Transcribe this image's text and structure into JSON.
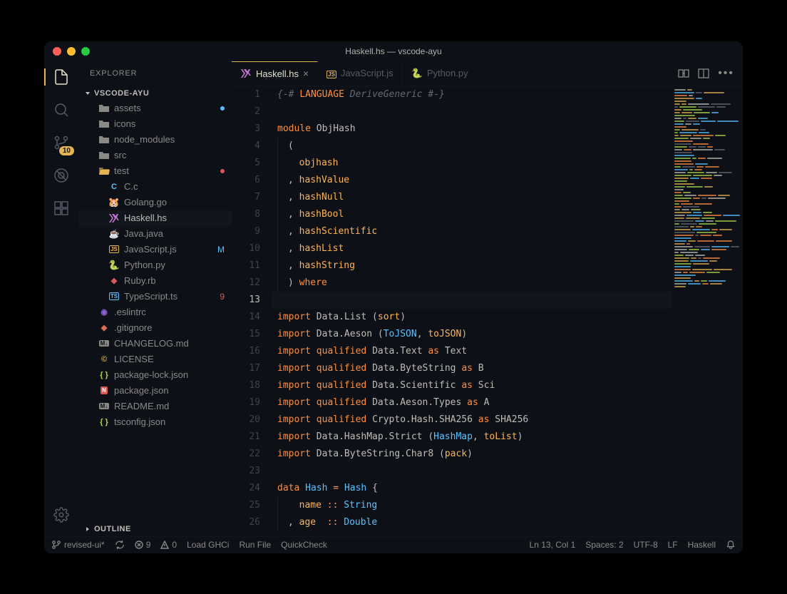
{
  "titlebar": {
    "title": "Haskell.hs — vscode-ayu"
  },
  "activity": {
    "items": [
      {
        "name": "files-icon",
        "active": true
      },
      {
        "name": "search-icon",
        "active": false
      },
      {
        "name": "source-control-icon",
        "active": false,
        "badge": "10"
      },
      {
        "name": "debug-icon",
        "active": false
      },
      {
        "name": "extensions-icon",
        "active": false
      }
    ],
    "bottom": {
      "name": "gear-icon"
    }
  },
  "sidebar": {
    "title": "EXPLORER",
    "project": "VSCODE-AYU",
    "outline": "OUTLINE",
    "tree": [
      {
        "type": "folder",
        "label": "assets",
        "indent": 1,
        "status_dot": "#59c2ff"
      },
      {
        "type": "folder",
        "label": "icons",
        "indent": 1
      },
      {
        "type": "folder",
        "label": "node_modules",
        "indent": 1
      },
      {
        "type": "folder",
        "label": "src",
        "indent": 1
      },
      {
        "type": "folder-open",
        "label": "test",
        "indent": 1,
        "icon_color": "#e6b450",
        "status_dot": "#d95757"
      },
      {
        "type": "file",
        "label": "C.c",
        "indent": 2,
        "icon": "c"
      },
      {
        "type": "file",
        "label": "Golang.go",
        "indent": 2,
        "icon": "go"
      },
      {
        "type": "file",
        "label": "Haskell.hs",
        "indent": 2,
        "icon": "hs",
        "active": true
      },
      {
        "type": "file",
        "label": "Java.java",
        "indent": 2,
        "icon": "java"
      },
      {
        "type": "file",
        "label": "JavaScript.js",
        "indent": 2,
        "icon": "js",
        "status_text": "M",
        "status_color": "#59c2ff"
      },
      {
        "type": "file",
        "label": "Python.py",
        "indent": 2,
        "icon": "py"
      },
      {
        "type": "file",
        "label": "Ruby.rb",
        "indent": 2,
        "icon": "rb"
      },
      {
        "type": "file",
        "label": "TypeScript.ts",
        "indent": 2,
        "icon": "ts",
        "status_text": "9",
        "status_color": "#d95757"
      },
      {
        "type": "file",
        "label": ".eslintrc",
        "indent": 1,
        "icon": "eslint"
      },
      {
        "type": "file",
        "label": ".gitignore",
        "indent": 1,
        "icon": "git"
      },
      {
        "type": "file",
        "label": "CHANGELOG.md",
        "indent": 1,
        "icon": "md"
      },
      {
        "type": "file",
        "label": "LICENSE",
        "indent": 1,
        "icon": "license"
      },
      {
        "type": "file",
        "label": "package-lock.json",
        "indent": 1,
        "icon": "json"
      },
      {
        "type": "file",
        "label": "package.json",
        "indent": 1,
        "icon": "npm"
      },
      {
        "type": "file",
        "label": "README.md",
        "indent": 1,
        "icon": "md"
      },
      {
        "type": "file",
        "label": "tsconfig.json",
        "indent": 1,
        "icon": "json"
      }
    ]
  },
  "tabs": [
    {
      "label": "Haskell.hs",
      "icon": "hs",
      "active": true,
      "close": true
    },
    {
      "label": "JavaScript.js",
      "icon": "js",
      "active": false
    },
    {
      "label": "Python.py",
      "icon": "py",
      "active": false
    }
  ],
  "editor": {
    "current_line": 13,
    "lines": [
      {
        "n": 1,
        "tokens": [
          [
            "c-comment",
            "{-# "
          ],
          [
            "c-keyword",
            "LANGUAGE"
          ],
          [
            "c-comment",
            " DeriveGeneric #-}"
          ]
        ]
      },
      {
        "n": 2,
        "tokens": []
      },
      {
        "n": 3,
        "tokens": [
          [
            "c-keyword",
            "module"
          ],
          [
            "",
            " "
          ],
          [
            "c-module",
            "ObjHash"
          ]
        ]
      },
      {
        "n": 4,
        "indent": 1,
        "tokens": [
          [
            "c-punct",
            "("
          ]
        ]
      },
      {
        "n": 5,
        "indent": 1,
        "tokens": [
          [
            "",
            "  "
          ],
          [
            "c-func",
            "objhash"
          ]
        ]
      },
      {
        "n": 6,
        "indent": 1,
        "tokens": [
          [
            "c-punct",
            ", "
          ],
          [
            "c-func",
            "hashValue"
          ]
        ]
      },
      {
        "n": 7,
        "indent": 1,
        "tokens": [
          [
            "c-punct",
            ", "
          ],
          [
            "c-func",
            "hashNull"
          ]
        ]
      },
      {
        "n": 8,
        "indent": 1,
        "tokens": [
          [
            "c-punct",
            ", "
          ],
          [
            "c-func",
            "hashBool"
          ]
        ]
      },
      {
        "n": 9,
        "indent": 1,
        "tokens": [
          [
            "c-punct",
            ", "
          ],
          [
            "c-func",
            "hashScientific"
          ]
        ]
      },
      {
        "n": 10,
        "indent": 1,
        "tokens": [
          [
            "c-punct",
            ", "
          ],
          [
            "c-func",
            "hashList"
          ]
        ]
      },
      {
        "n": 11,
        "indent": 1,
        "tokens": [
          [
            "c-punct",
            ", "
          ],
          [
            "c-func",
            "hashString"
          ]
        ]
      },
      {
        "n": 12,
        "indent": 1,
        "tokens": [
          [
            "c-punct",
            ") "
          ],
          [
            "c-keyword",
            "where"
          ]
        ]
      },
      {
        "n": 13,
        "tokens": []
      },
      {
        "n": 14,
        "tokens": [
          [
            "c-keyword",
            "import"
          ],
          [
            "",
            " Data.List ("
          ],
          [
            "c-func",
            "sort"
          ],
          [
            "",
            ")"
          ]
        ]
      },
      {
        "n": 15,
        "tokens": [
          [
            "c-keyword",
            "import"
          ],
          [
            "",
            " Data.Aeson ("
          ],
          [
            "c-type",
            "ToJSON"
          ],
          [
            "",
            ", "
          ],
          [
            "c-func",
            "toJSON"
          ],
          [
            "",
            ")"
          ]
        ]
      },
      {
        "n": 16,
        "tokens": [
          [
            "c-keyword",
            "import"
          ],
          [
            "",
            " "
          ],
          [
            "c-keyword",
            "qualified"
          ],
          [
            "",
            " Data.Text "
          ],
          [
            "c-keyword",
            "as"
          ],
          [
            "",
            " Text"
          ]
        ]
      },
      {
        "n": 17,
        "tokens": [
          [
            "c-keyword",
            "import"
          ],
          [
            "",
            " "
          ],
          [
            "c-keyword",
            "qualified"
          ],
          [
            "",
            " Data.ByteString "
          ],
          [
            "c-keyword",
            "as"
          ],
          [
            "",
            " B"
          ]
        ]
      },
      {
        "n": 18,
        "tokens": [
          [
            "c-keyword",
            "import"
          ],
          [
            "",
            " "
          ],
          [
            "c-keyword",
            "qualified"
          ],
          [
            "",
            " Data.Scientific "
          ],
          [
            "c-keyword",
            "as"
          ],
          [
            "",
            " Sci"
          ]
        ]
      },
      {
        "n": 19,
        "tokens": [
          [
            "c-keyword",
            "import"
          ],
          [
            "",
            " "
          ],
          [
            "c-keyword",
            "qualified"
          ],
          [
            "",
            " Data.Aeson.Types "
          ],
          [
            "c-keyword",
            "as"
          ],
          [
            "",
            " A"
          ]
        ]
      },
      {
        "n": 20,
        "tokens": [
          [
            "c-keyword",
            "import"
          ],
          [
            "",
            " "
          ],
          [
            "c-keyword",
            "qualified"
          ],
          [
            "",
            " Crypto.Hash.SHA256 "
          ],
          [
            "c-keyword",
            "as"
          ],
          [
            "",
            " SHA256"
          ]
        ]
      },
      {
        "n": 21,
        "tokens": [
          [
            "c-keyword",
            "import"
          ],
          [
            "",
            " Data.HashMap.Strict ("
          ],
          [
            "c-type",
            "HashMap"
          ],
          [
            "",
            ", "
          ],
          [
            "c-func",
            "toList"
          ],
          [
            "",
            ")"
          ]
        ]
      },
      {
        "n": 22,
        "tokens": [
          [
            "c-keyword",
            "import"
          ],
          [
            "",
            " Data.ByteString.Char8 ("
          ],
          [
            "c-func",
            "pack"
          ],
          [
            "",
            ")"
          ]
        ]
      },
      {
        "n": 23,
        "tokens": []
      },
      {
        "n": 24,
        "tokens": [
          [
            "c-keyword",
            "data"
          ],
          [
            "",
            " "
          ],
          [
            "c-type",
            "Hash"
          ],
          [
            "",
            " "
          ],
          [
            "c-op",
            "="
          ],
          [
            "",
            " "
          ],
          [
            "c-type",
            "Hash"
          ],
          [
            "",
            " {"
          ]
        ]
      },
      {
        "n": 25,
        "indent": 1,
        "tokens": [
          [
            "",
            "  "
          ],
          [
            "c-func",
            "name"
          ],
          [
            "",
            " "
          ],
          [
            "c-op",
            "::"
          ],
          [
            "",
            " "
          ],
          [
            "c-type",
            "String"
          ]
        ]
      },
      {
        "n": 26,
        "indent": 1,
        "tokens": [
          [
            "c-punct",
            ", "
          ],
          [
            "c-func",
            "age"
          ],
          [
            "",
            "  "
          ],
          [
            "c-op",
            "::"
          ],
          [
            "",
            " "
          ],
          [
            "c-type",
            "Double"
          ]
        ]
      }
    ]
  },
  "statusbar": {
    "branch": "revised-ui*",
    "sync_icon": "sync",
    "errors": "9",
    "warnings": "0",
    "actions": [
      "Load GHCi",
      "Run File",
      "QuickCheck"
    ],
    "position": "Ln 13, Col 1",
    "spaces": "Spaces: 2",
    "encoding": "UTF-8",
    "eol": "LF",
    "language": "Haskell",
    "bell": "bell-icon"
  },
  "icons": {
    "folder_color": "#8a8986",
    "folder_open_color": "#e6b450"
  }
}
